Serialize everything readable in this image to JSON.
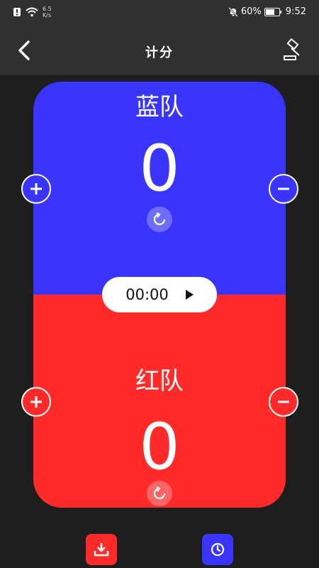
{
  "status_bar": {
    "net_speed_value": "6.5",
    "net_speed_unit": "K/s",
    "battery": "60%",
    "time": "9:52"
  },
  "header": {
    "title": "计分"
  },
  "teams": {
    "blue": {
      "name": "蓝队",
      "score": "0",
      "color": "#3a34ff"
    },
    "red": {
      "name": "红队",
      "score": "0",
      "color": "#ff2a2a"
    }
  },
  "timer": {
    "display": "00:00"
  },
  "icons": {
    "back": "chevron-left-icon",
    "judge": "gavel-icon",
    "plus": "plus-circle-icon",
    "minus": "minus-circle-icon",
    "reset": "refresh-icon",
    "play": "play-icon",
    "save": "download-icon",
    "history": "clock-icon"
  }
}
